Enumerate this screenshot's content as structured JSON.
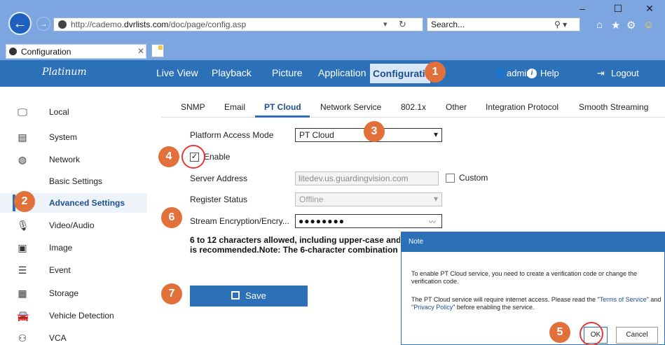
{
  "browser": {
    "url_prefix": "http://cademo.",
    "url_domain": "dvrlists.com",
    "url_path": "/doc/page/config.asp",
    "search_placeholder": "Search...",
    "tab_title": "Configuration"
  },
  "header": {
    "brand": "Platinum",
    "nav": [
      "Live View",
      "Playback",
      "Picture",
      "Application",
      "Configuration"
    ],
    "user": "admin",
    "help": "Help",
    "logout": "Logout"
  },
  "sidebar": {
    "items": [
      {
        "label": "Local",
        "icon": "monitor-icon"
      },
      {
        "label": "System",
        "icon": "system-icon"
      },
      {
        "label": "Network",
        "icon": "globe-icon"
      },
      {
        "label": "Basic Settings",
        "icon": ""
      },
      {
        "label": "Advanced Settings",
        "icon": ""
      },
      {
        "label": "Video/Audio",
        "icon": "video-audio-icon"
      },
      {
        "label": "Image",
        "icon": "image-icon"
      },
      {
        "label": "Event",
        "icon": "event-icon"
      },
      {
        "label": "Storage",
        "icon": "storage-icon"
      },
      {
        "label": "Vehicle Detection",
        "icon": "vehicle-icon"
      },
      {
        "label": "VCA",
        "icon": "vca-icon"
      }
    ]
  },
  "subtabs": [
    "SNMP",
    "Email",
    "PT Cloud",
    "Network Service",
    "802.1x",
    "Other",
    "Integration Protocol",
    "Smooth Streaming"
  ],
  "form": {
    "platform_label": "Platform Access Mode",
    "platform_value": "PT Cloud",
    "enable_label": "Enable",
    "server_label": "Server Address",
    "server_value": "litedev.us.guardingvision.com",
    "custom_label": "Custom",
    "register_label": "Register Status",
    "register_value": "Offline",
    "stream_label": "Stream Encryption/Encry...",
    "stream_value": "●●●●●●●●",
    "hint_line1": "6 to 12 characters allowed, including upper-case and",
    "hint_line2": "is recommended.Note: The 6-character combination",
    "save_label": "Save"
  },
  "dialog": {
    "title": "Note",
    "text1": "To enable PT Cloud service, you need to create a verification code or change the verification code.",
    "text2_pre": "The PT Cloud service will require internet access. Please read the \"",
    "tos": "Terms of Service",
    "text2_mid": "\" and \"",
    "privacy": "Privacy Policy",
    "text2_post": "\" before enabling the service.",
    "ok": "OK",
    "cancel": "Cancel"
  },
  "steps": [
    "1",
    "2",
    "3",
    "4",
    "5",
    "6",
    "7"
  ],
  "colors": {
    "accent": "#2c71b8",
    "badge": "#e2703a"
  }
}
